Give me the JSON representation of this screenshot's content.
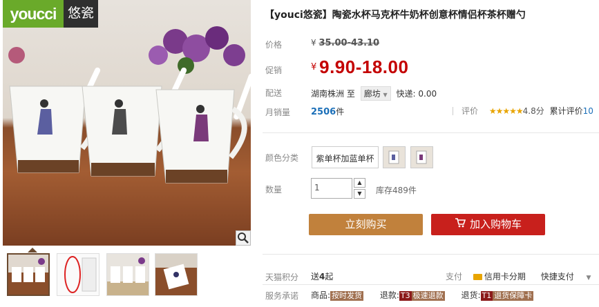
{
  "brand": {
    "logo_en": "youcci",
    "logo_cn": "悠瓷"
  },
  "product": {
    "title": "【youci悠瓷】陶瓷水杯马克杯牛奶杯创意杯情侣杯茶杯赠勺",
    "price_label": "价格",
    "currency": "¥",
    "price": "35.00-43.10",
    "promo_label": "促销",
    "promo_price": "9.90-18.00",
    "ship_label": "配送",
    "ship_from": "湖南株洲",
    "ship_to_word": "至",
    "ship_dest": "廊坊",
    "ship_fee": "快递: 0.00",
    "sales_label": "月销量",
    "sales_count": "2506",
    "sales_unit": "件",
    "rate_label": "评价",
    "stars": "★★★★★",
    "rate_score": "4.8分",
    "total_review_label": "累计评价",
    "total_review_count": "10"
  },
  "options": {
    "color_label": "颜色分类",
    "color_selected": "紫单杯加蓝单杯",
    "qty_label": "数量",
    "qty_value": "1",
    "qty_up": "▲",
    "qty_down": "▼",
    "stock": "库存489件"
  },
  "actions": {
    "buy": "立刻购买",
    "cart": "加入购物车"
  },
  "points": {
    "label": "天猫积分",
    "prefix": "送",
    "value": "4",
    "suffix": "起"
  },
  "payment": {
    "label": "支付",
    "credit": "信用卡分期",
    "fast": "快捷支付",
    "more": "▼"
  },
  "service": {
    "label": "服务承诺",
    "goods_label": "商品:",
    "goods_badge": "按时发货",
    "refund_label": "退款:",
    "refund_code": "T3",
    "refund_badge": "极速退款",
    "return_label": "退货:",
    "return_code": "T1",
    "return_badge": "退货保障卡"
  },
  "colors": {
    "promo": "#c40000",
    "buy": "#c1813c",
    "cart": "#c8201c",
    "link": "#1b6fb8",
    "brand_green": "#6aaa2a"
  }
}
